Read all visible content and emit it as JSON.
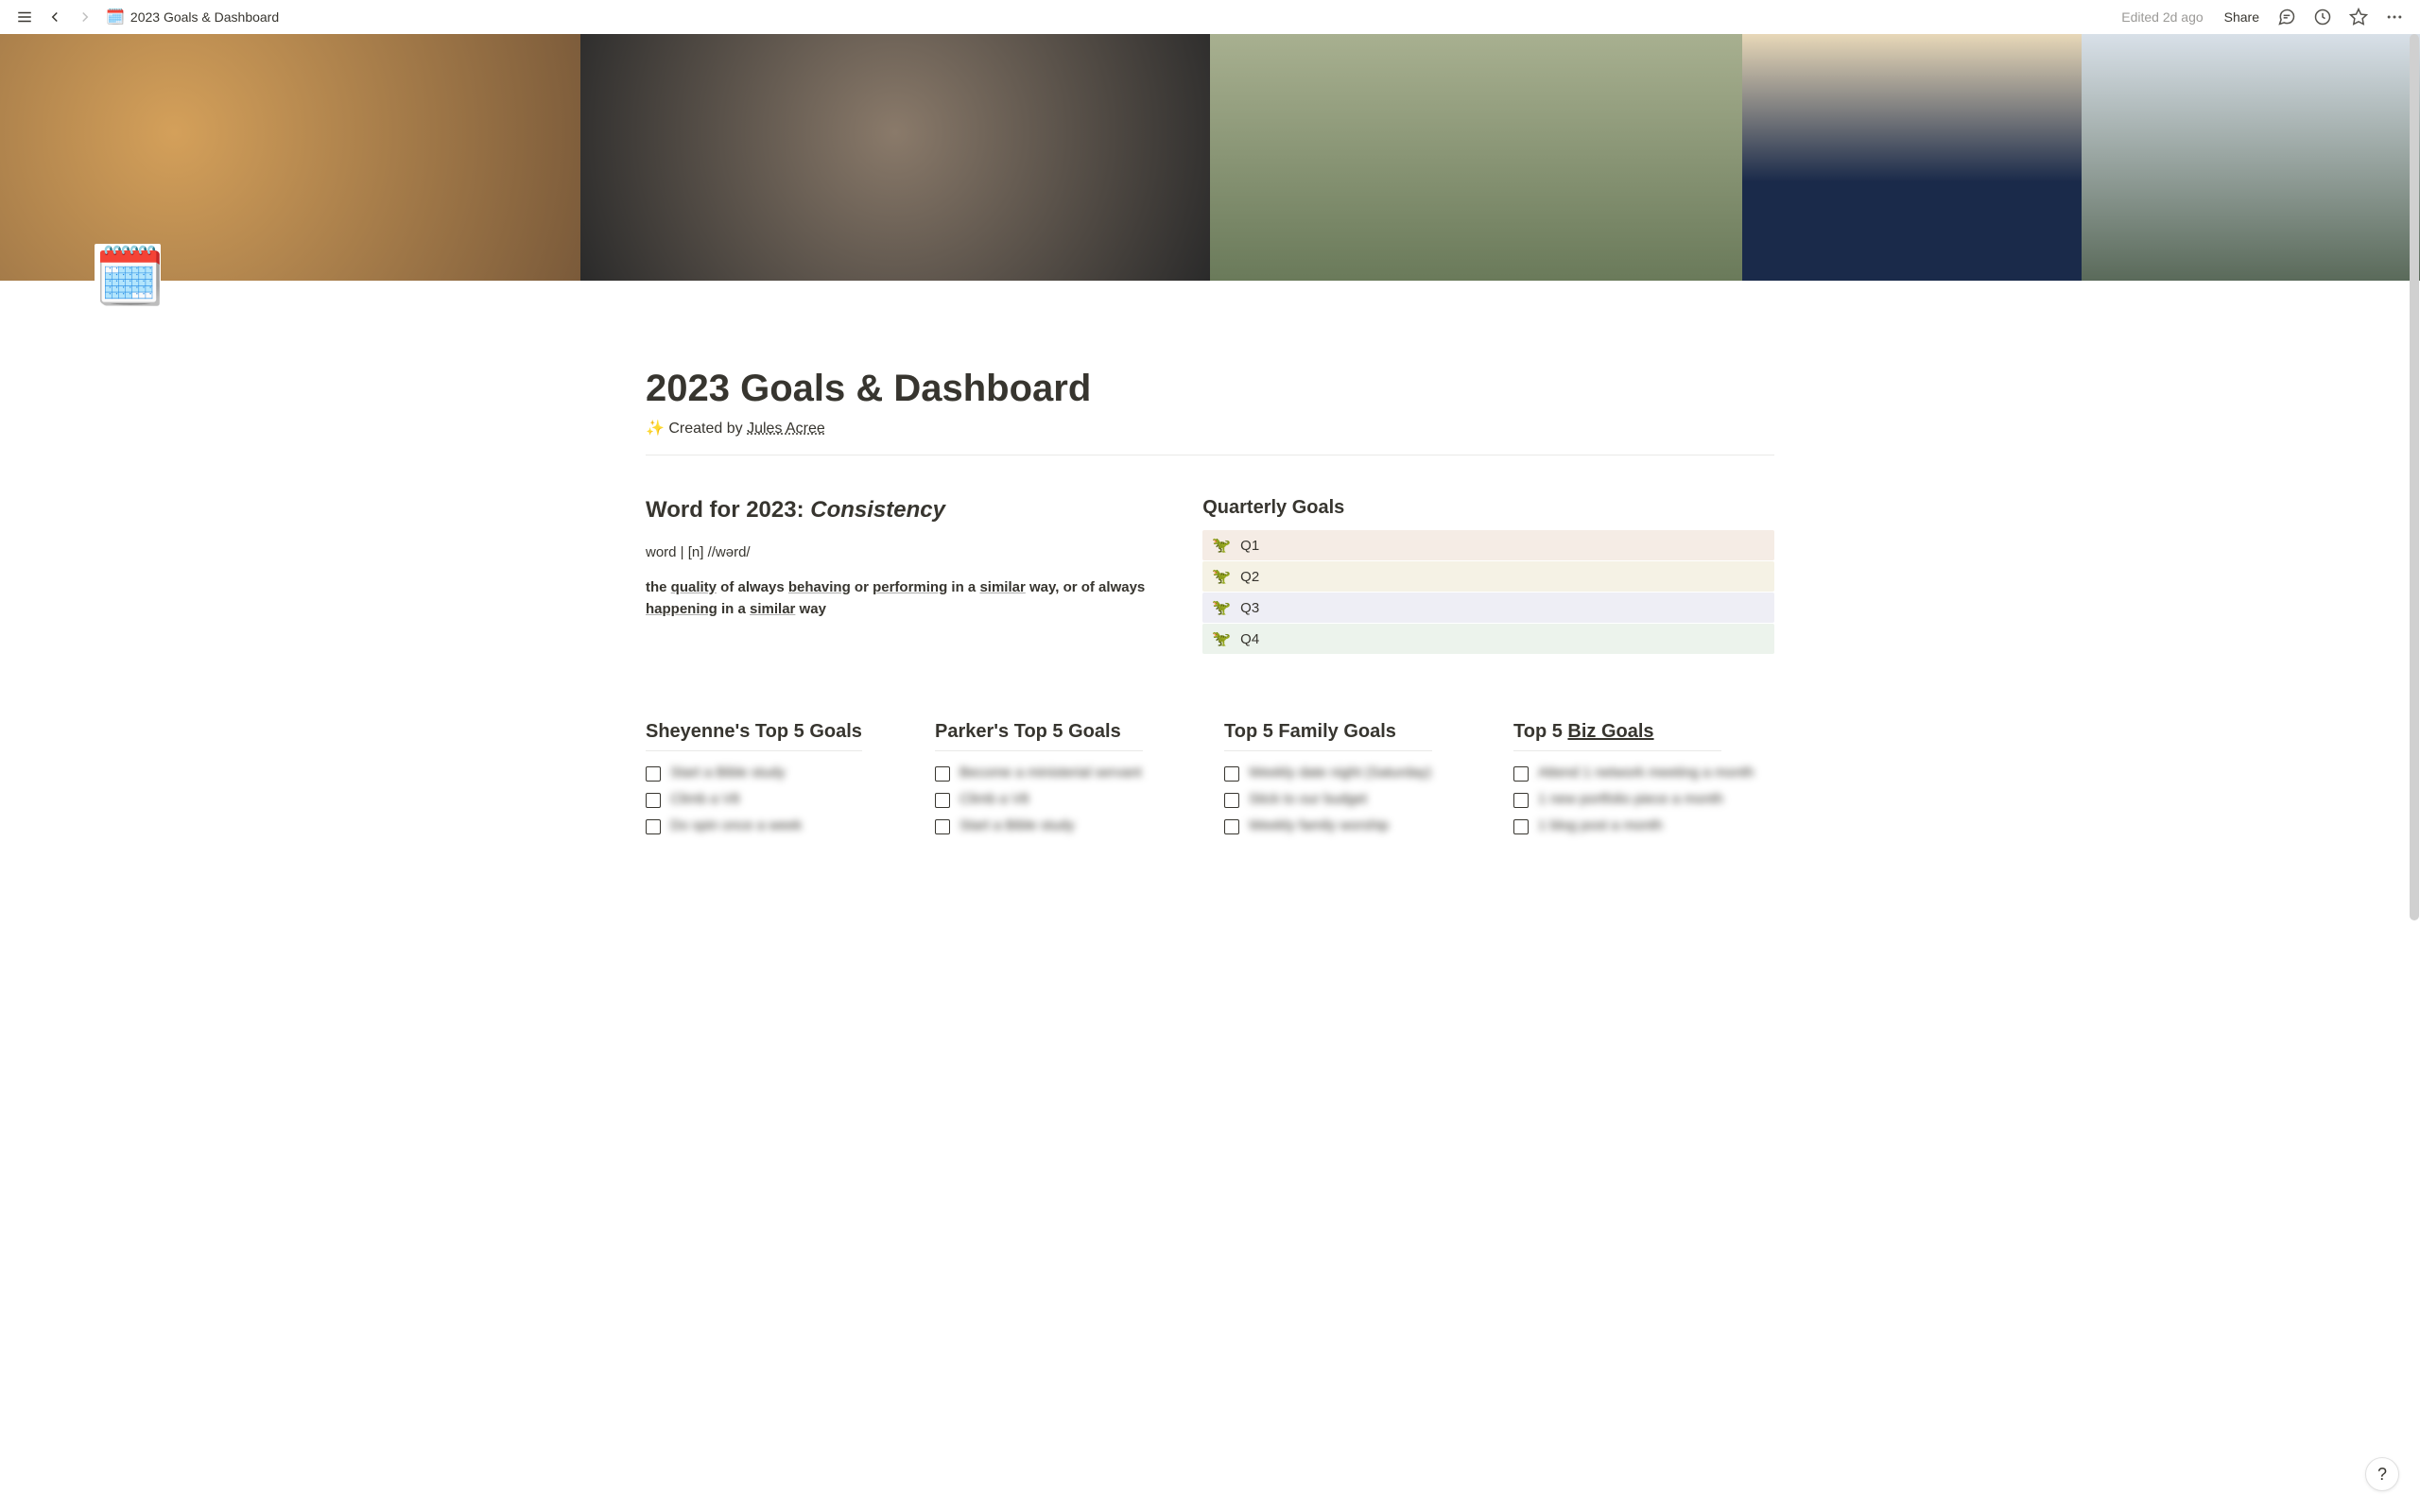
{
  "topbar": {
    "page_icon": "🗓️",
    "page_title": "2023 Goals & Dashboard",
    "edited": "Edited 2d ago",
    "share": "Share"
  },
  "page": {
    "icon": "🗓️",
    "title": "2023 Goals & Dashboard",
    "created_prefix": "Created by ",
    "author": "Jules Acree"
  },
  "word_section": {
    "heading_prefix": "Word for 2023: ",
    "word": "Consistency",
    "pronunciation": "word | [n] //wərd/",
    "definition_parts": {
      "p1": "the ",
      "quality": "quality",
      "p2": " of always ",
      "behaving": "behaving",
      "p3": " or ",
      "performing": "performing",
      "p4": " in a ",
      "similar1": "similar",
      "p5": " way, or of always ",
      "happening": "happening",
      "p6": " in a ",
      "similar2": "similar",
      "p7": " way"
    }
  },
  "quarterly": {
    "heading": "Quarterly Goals",
    "emoji": "🦖",
    "items": [
      "Q1",
      "Q2",
      "Q3",
      "Q4"
    ]
  },
  "goal_columns": [
    {
      "heading": "Sheyenne's Top 5  Goals",
      "items": [
        "Start a Bible study",
        "Climb a V8",
        "Do spin once a week"
      ]
    },
    {
      "heading": "Parker's Top 5 Goals",
      "items": [
        "Become a ministerial servant",
        "Climb a V8",
        "Start a Bible study"
      ]
    },
    {
      "heading": "Top 5 Family Goals",
      "items": [
        "Weekly date night (Saturday)",
        "Stick to our budget",
        "Weekly family worship"
      ]
    },
    {
      "heading_prefix": "Top 5 ",
      "heading_link": "Biz Goals",
      "items": [
        "Attend 1 network meeting a month",
        "1 new portfolio piece a month",
        "1 blog post a month"
      ]
    }
  ],
  "help": "?"
}
